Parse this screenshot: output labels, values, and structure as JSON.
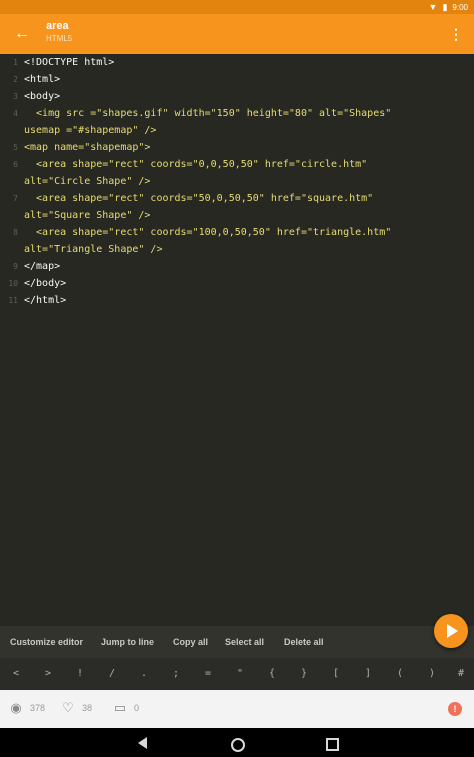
{
  "status_bar": {
    "time": "9:00"
  },
  "app_bar": {
    "title": "area",
    "subtitle": "HTML5"
  },
  "code_lines": [
    {
      "n": "1",
      "plain": "<!DOCTYPE html>",
      "str": ""
    },
    {
      "n": "2",
      "plain": "<html>",
      "str": ""
    },
    {
      "n": "3",
      "plain": "<body>",
      "str": ""
    },
    {
      "n": "4",
      "plain": "  <img src =\"shapes.gif\" width=\"150\" height=\"80\" alt=\"Shapes\"",
      "str": ""
    },
    {
      "n": "",
      "plain": "usemap =\"#shapemap\" />",
      "str": ""
    },
    {
      "n": "5",
      "plain": "<map name=\"shapemap\">",
      "str": ""
    },
    {
      "n": "6",
      "plain": "  <area shape=\"rect\" coords=\"0,0,50,50\" href=\"circle.htm\"",
      "str": ""
    },
    {
      "n": "",
      "plain": "alt=\"Circle Shape\" />",
      "str": ""
    },
    {
      "n": "7",
      "plain": "  <area shape=\"rect\" coords=\"50,0,50,50\" href=\"square.htm\"",
      "str": ""
    },
    {
      "n": "",
      "plain": "alt=\"Square Shape\" />",
      "str": ""
    },
    {
      "n": "8",
      "plain": "  <area shape=\"rect\" coords=\"100,0,50,50\" href=\"triangle.htm\"",
      "str": ""
    },
    {
      "n": "",
      "plain": "alt=\"Triangle Shape\" />",
      "str": ""
    },
    {
      "n": "9",
      "plain": "</map>",
      "str": ""
    },
    {
      "n": "10",
      "plain": "</body>",
      "str": ""
    },
    {
      "n": "11",
      "plain": "</html>",
      "str": ""
    }
  ],
  "toolbar": {
    "customize_editor": "Customize editor",
    "jump_to_line": "Jump to line",
    "copy_all": "Copy all",
    "select_all": "Select all",
    "delete_all": "Delete all"
  },
  "symbols": [
    "<",
    ">",
    "!",
    "/",
    ".",
    ";",
    "=",
    "\"",
    "{",
    "}",
    "[",
    "]",
    "(",
    ")",
    "#"
  ],
  "social": {
    "views": "378",
    "likes": "38",
    "comments": "0"
  },
  "colors": {
    "accent": "#f7941d",
    "editor_bg": "#272822",
    "string": "#e6db74"
  }
}
